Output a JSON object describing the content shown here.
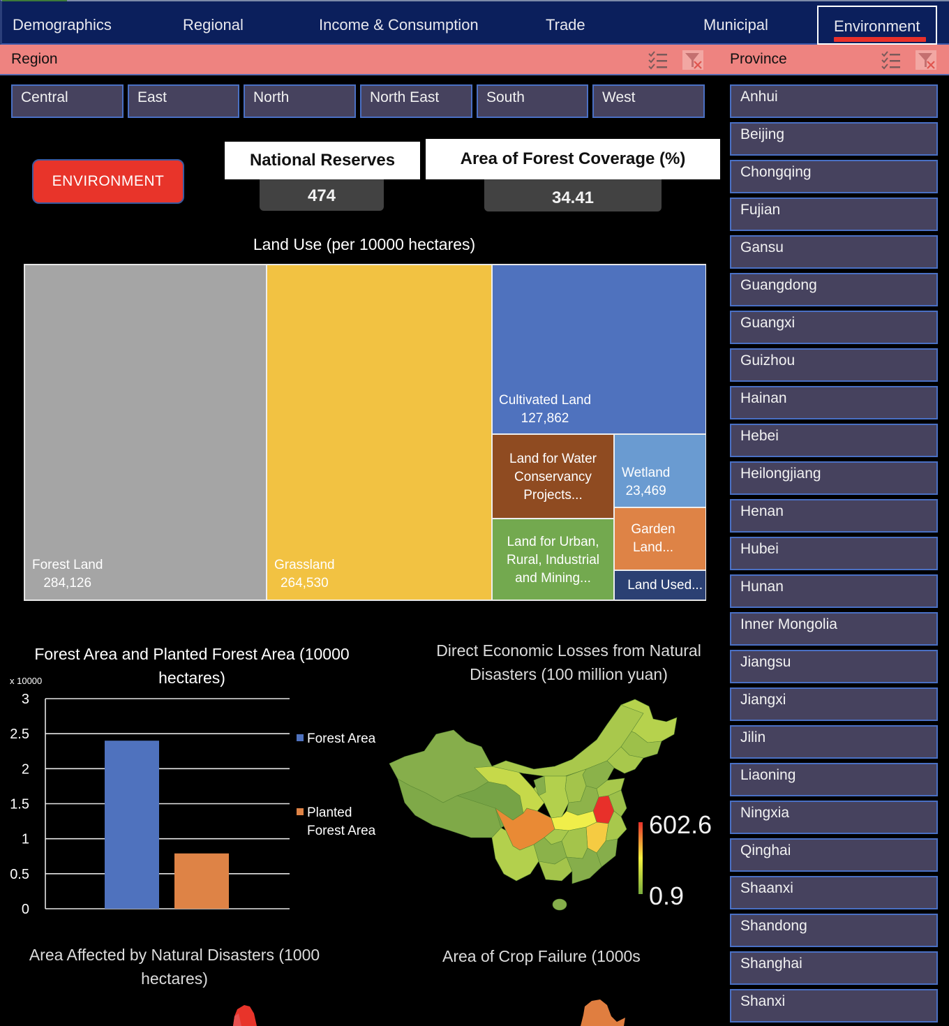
{
  "nav": {
    "tabs": [
      {
        "label": "Demographics",
        "active": false
      },
      {
        "label": "Regional",
        "active": false
      },
      {
        "label": "Income & Consumption",
        "active": false
      },
      {
        "label": "Trade",
        "active": false
      },
      {
        "label": "Municipal",
        "active": false
      },
      {
        "label": "Environment",
        "active": true
      }
    ],
    "accent_color": "#e8302a"
  },
  "slicers": {
    "region": {
      "title": "Region",
      "items": [
        "Central",
        "East",
        "North",
        "North East",
        "South",
        "West"
      ]
    },
    "province": {
      "title": "Province",
      "items": [
        "Anhui",
        "Beijing",
        "Chongqing",
        "Fujian",
        "Gansu",
        "Guangdong",
        "Guangxi",
        "Guizhou",
        "Hainan",
        "Hebei",
        "Heilongjiang",
        "Henan",
        "Hubei",
        "Hunan",
        "Inner Mongolia",
        "Jiangsu",
        "Jiangxi",
        "Jilin",
        "Liaoning",
        "Ningxia",
        "Qinghai",
        "Shaanxi",
        "Shandong",
        "Shanghai",
        "Shanxi"
      ]
    },
    "icons": {
      "multi_select": "multi-select-icon",
      "clear_filter": "clear-filter-icon"
    }
  },
  "page_badge": {
    "label": "ENVIRONMENT",
    "color": "#e8342a"
  },
  "kpis": [
    {
      "title": "National Reserves",
      "value": "474"
    },
    {
      "title": "Area of Forest Coverage (%)",
      "value": "34.41"
    }
  ],
  "treemap": {
    "title": "Land Use (per 10000 hectares)",
    "cells": [
      {
        "label": "Forest Land",
        "value": "284,126",
        "color": "#a5a5a5"
      },
      {
        "label": "Grassland",
        "value": "264,530",
        "color": "#f2c242"
      },
      {
        "label": "Cultivated Land",
        "value": "127,862",
        "color": "#4f72be"
      },
      {
        "label": "Land for Water Conservancy Projects...",
        "value": "",
        "color": "#8f4b21"
      },
      {
        "label": "Wetland",
        "value": "23,469",
        "color": "#6a9bd1"
      },
      {
        "label": "Land for Urban, Rural, Industrial and Mining...",
        "value": "",
        "color": "#73a94f"
      },
      {
        "label": "Garden Land...",
        "value": "",
        "color": "#de8346"
      },
      {
        "label": "Land Used...",
        "value": "",
        "color": "#2b4073"
      }
    ]
  },
  "chart_data": [
    {
      "type": "bar",
      "title": "Forest Area and Planted Forest Area (10000 hectares)",
      "axis_multiplier_label": "x 10000",
      "categories": [
        ""
      ],
      "series": [
        {
          "name": "Forest Area",
          "values": [
            2.4
          ],
          "color": "#4f72be"
        },
        {
          "name": "Planted Forest Area",
          "values": [
            0.79
          ],
          "color": "#de8346"
        }
      ],
      "ylim": [
        0,
        3
      ],
      "yticks": [
        "0",
        "0.5",
        "1",
        "1.5",
        "2",
        "2.5",
        "3"
      ],
      "ytick_values": [
        0,
        0.5,
        1,
        1.5,
        2,
        2.5,
        3
      ],
      "grid": true,
      "legend": "right"
    },
    {
      "type": "heatmap",
      "title": "Direct Economic Losses from Natural Disasters (100 million yuan)",
      "subtype": "choropleth-map",
      "scale_max": "602.6",
      "scale_min": "0.9",
      "scale_colors": [
        "#7aad3e",
        "#f4f23e",
        "#e8302a"
      ]
    },
    {
      "type": "heatmap",
      "title": "Area Affected by Natural Disasters (1000 hectares)",
      "subtype": "choropleth-map"
    },
    {
      "type": "heatmap",
      "title": "Area of Crop Failure (1000s",
      "subtype": "choropleth-map"
    }
  ]
}
